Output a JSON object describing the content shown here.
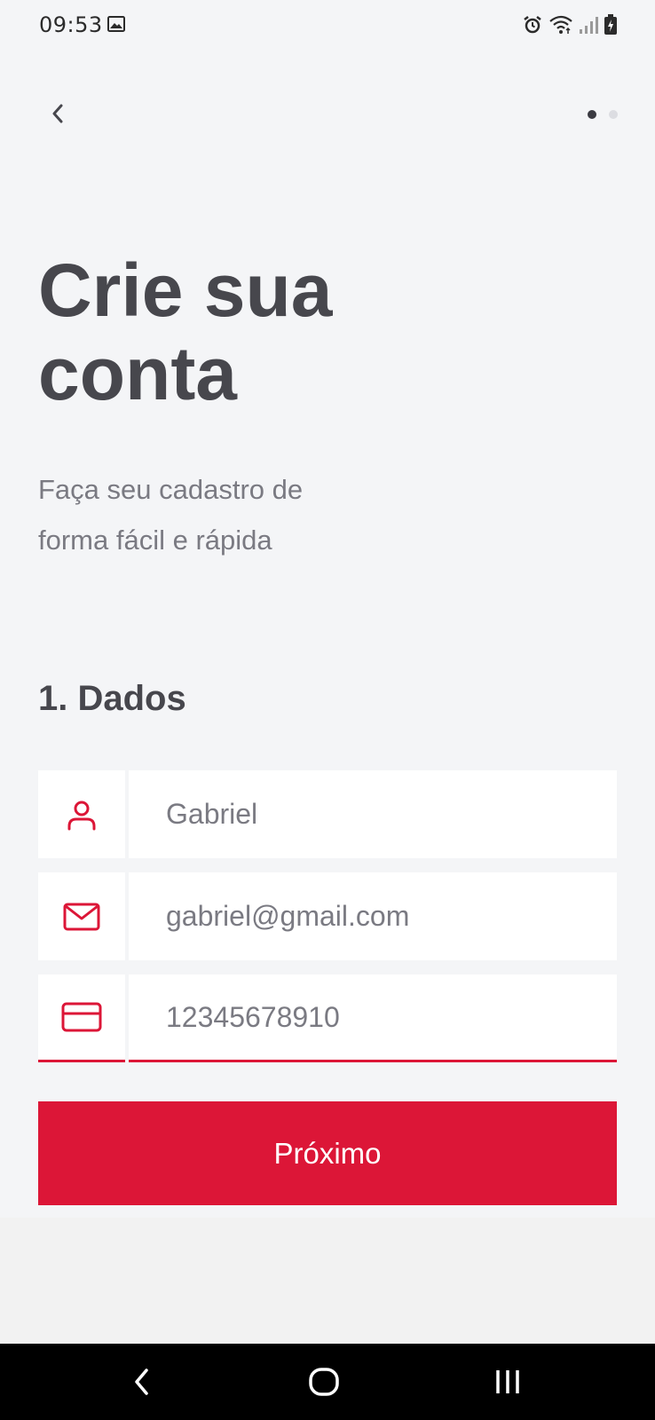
{
  "status_bar": {
    "time": "09:53",
    "icons": [
      "image-icon",
      "alarm-icon",
      "wifi-icon",
      "signal-icon",
      "battery-icon"
    ]
  },
  "header": {
    "back_icon": "chevron-left-icon",
    "steps_total": 2,
    "step_active": 1
  },
  "hero": {
    "title": "Crie sua conta",
    "subtitle": "Faça seu cadastro de forma fácil e rápida"
  },
  "form": {
    "section_title": "1. Dados",
    "fields": [
      {
        "icon": "user-icon",
        "value": "Gabriel"
      },
      {
        "icon": "mail-icon",
        "value": "gabriel@gmail.com"
      },
      {
        "icon": "credit-card-icon",
        "value": "12345678910"
      }
    ],
    "next_label": "Próximo"
  },
  "colors": {
    "accent": "#dc1637",
    "background": "#f4f5f7",
    "title": "#47474d",
    "subtitle": "#7a7a82"
  },
  "system_nav": {
    "icons": [
      "back-icon",
      "home-icon",
      "recents-icon"
    ]
  }
}
